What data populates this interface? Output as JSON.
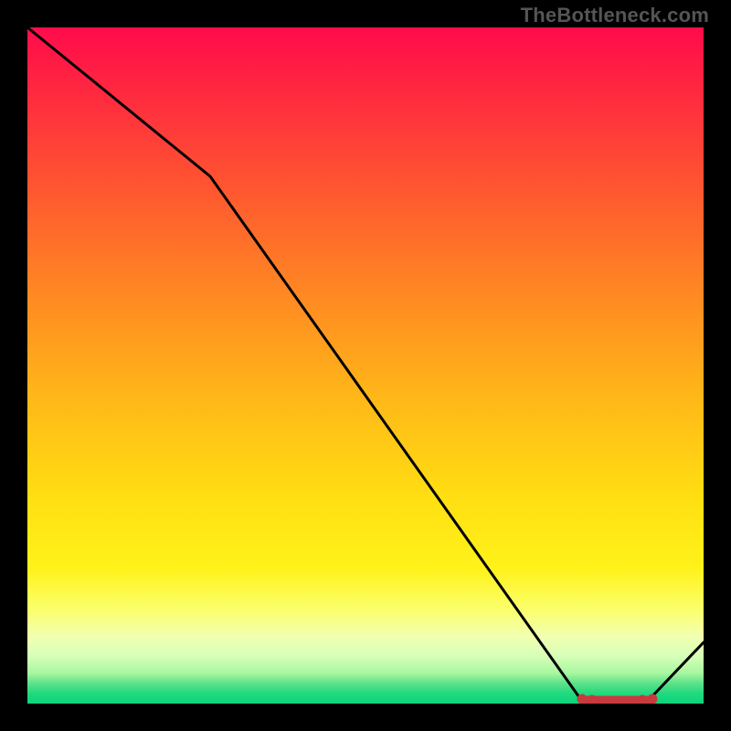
{
  "attribution": "TheBottleneck.com",
  "chart_data": {
    "type": "line",
    "title": "",
    "xlabel": "",
    "ylabel": "",
    "ylim": [
      0,
      100
    ],
    "xlim": [
      0,
      100
    ],
    "x": [
      0,
      27,
      82,
      92,
      100
    ],
    "values": [
      100,
      78,
      0.5,
      0.5,
      9
    ],
    "series": [
      {
        "name": "curve",
        "values": [
          100,
          78,
          0.5,
          0.5,
          9
        ]
      }
    ],
    "categories": [
      0,
      27,
      82,
      92,
      100
    ],
    "markers": {
      "y": 0.5,
      "x_range": [
        82,
        92
      ],
      "color": "#c83a3f"
    },
    "background_gradient": {
      "top_color": "#ff0b4b",
      "mid_color": "#ffe012",
      "bottom_color": "#0bd47c"
    }
  }
}
